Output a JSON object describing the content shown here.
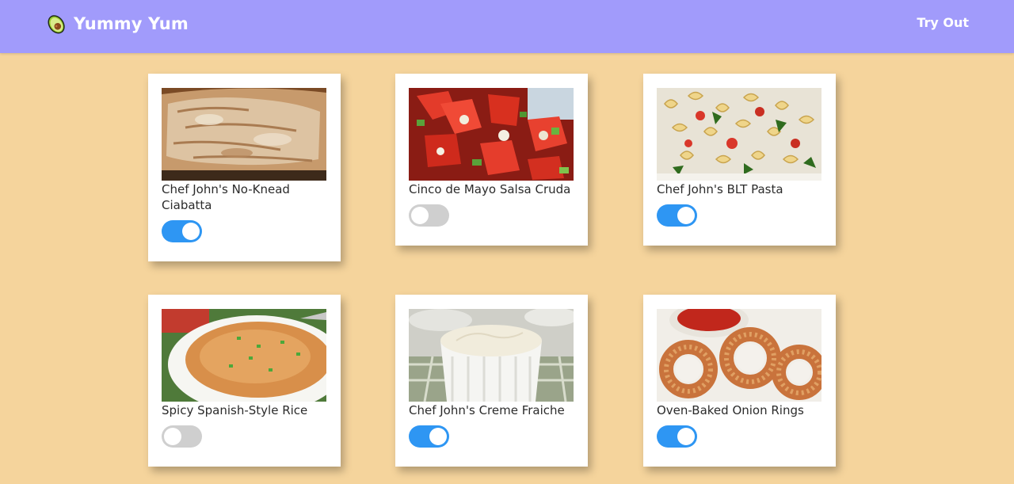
{
  "app": {
    "title": "Yummy Yum",
    "logo_icon": "avocado-icon",
    "nav_link": "Try Out"
  },
  "colors": {
    "background": "#f5d49c",
    "navbar": "#a19bfb",
    "toggle_on": "#2e96f3",
    "toggle_off": "#cfcfcf"
  },
  "recipes": [
    {
      "title": "Chef John's No-Knead Ciabatta",
      "image": "ciabatta-bread-photo",
      "selected": true
    },
    {
      "title": "Cinco de Mayo Salsa Cruda",
      "image": "salsa-cruda-photo",
      "selected": false
    },
    {
      "title": "Chef John's BLT Pasta",
      "image": "blt-pasta-photo",
      "selected": true
    },
    {
      "title": "Spicy Spanish-Style Rice",
      "image": "spanish-rice-photo",
      "selected": false
    },
    {
      "title": "Chef John's Creme Fraiche",
      "image": "creme-fraiche-photo",
      "selected": true
    },
    {
      "title": "Oven-Baked Onion Rings",
      "image": "onion-rings-photo",
      "selected": true
    }
  ]
}
